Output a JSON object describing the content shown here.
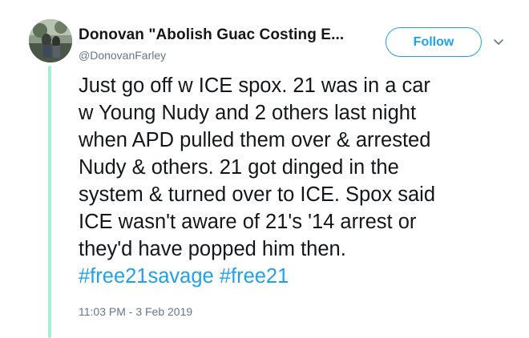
{
  "tweet": {
    "author": {
      "display_name": "Donovan \"Abolish Guac Costing E...",
      "handle": "@DonovanFarley"
    },
    "follow_label": "Follow",
    "menu_icon": "chevron-down-icon",
    "text_lines": [
      "Just go off w ICE spox. 21 was in a car",
      "w Young Nudy and 2 others last night",
      "when APD pulled them over & arrested",
      "Nudy & others. 21 got dinged in the",
      "system & turned over to ICE. Spox said",
      "ICE wasn't aware of 21's '14 arrest or",
      "they'd have popped him then."
    ],
    "hashtags": [
      "#free21savage",
      "#free21"
    ],
    "timestamp": "11:03 PM - 3 Feb 2019"
  },
  "colors": {
    "accent": "#1da1f2",
    "thread_line": "#a7eed7",
    "secondary_text": "#657786",
    "primary_text": "#14171a"
  }
}
